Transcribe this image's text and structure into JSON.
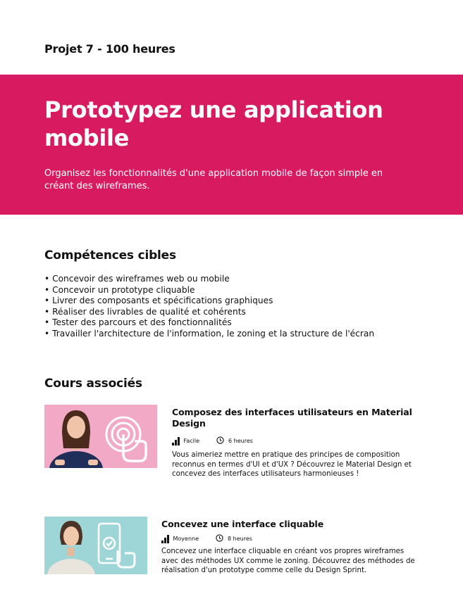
{
  "project_label": "Projet 7 - 100 heures",
  "hero": {
    "title": "Prototypez une application mobile",
    "description": "Organisez les fonctionnalités d'une application mobile de façon simple en créant des wireframes.",
    "background_color": "#D81B60"
  },
  "skills": {
    "heading": "Compétences cibles",
    "items": [
      "Concevoir des wireframes web ou mobile",
      "Concevoir un prototype cliquable",
      "Livrer des composants et spécifications graphiques",
      "Réaliser des livrables de qualité et cohérents",
      "Tester des parcours et des fonctionnalités",
      "Travailler l'architecture de l'information, le zoning et la structure de l'écran"
    ]
  },
  "courses": {
    "heading": "Cours associés",
    "items": [
      {
        "title": "Composez des interfaces utilisateurs en Material Design",
        "difficulty": "Facile",
        "duration": "6 heures",
        "description": "Vous aimeriez mettre en pratique des principes de composition reconnus en termes d'UI et d'UX ? Découvrez le Material Design et concevez des interfaces utilisateurs harmonieuses !",
        "thumb_color": "#F2A9C6",
        "thumb_icon": "touch-click-icon"
      },
      {
        "title": "Concevez une interface cliquable",
        "difficulty": "Moyenne",
        "duration": "8 heures",
        "description": "Concevez une interface cliquable en créant vos propres wireframes avec des méthodes UX comme le zoning. Découvrez des méthodes de réalisation d'un prototype comme celle du Design Sprint.",
        "thumb_color": "#9ED6D8",
        "thumb_icon": "phone-tap-icon"
      }
    ]
  }
}
